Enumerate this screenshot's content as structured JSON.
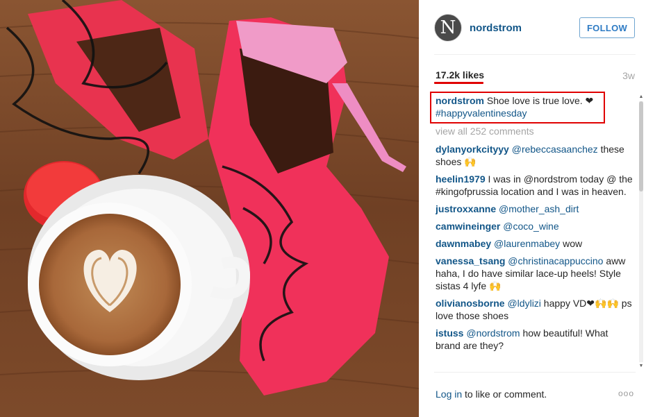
{
  "profile": {
    "username": "nordstrom",
    "avatar_letter": "N",
    "follow_label": "FOLLOW"
  },
  "post": {
    "likes": "17.2k likes",
    "time": "3w",
    "caption": {
      "user": "nordstrom",
      "text": " Shoe love is true love. ❤ ",
      "hashtag": "#happyvalentinesday"
    },
    "view_all": "view all 252 comments",
    "comments": [
      {
        "user": "dylanyorkcityyy",
        "mention": "@rebeccasaanchez",
        "text": " these shoes 🙌"
      },
      {
        "user": "heelin1979",
        "mention": "",
        "text": " I was in @nordstrom today @ the #kingofprussia location and I was in heaven."
      },
      {
        "user": "justroxxanne",
        "mention": "@mother_ash_dirt",
        "text": ""
      },
      {
        "user": "camwineinger",
        "mention": "@coco_wine",
        "text": ""
      },
      {
        "user": "dawnmabey",
        "mention": "@laurenmabey",
        "text": " wow"
      },
      {
        "user": "vanessa_tsang",
        "mention": "@christinacappuccino",
        "text": " aww haha, I do have similar lace-up heels! Style sistas 4 lyfe 🙌"
      },
      {
        "user": "olivianosborne",
        "mention": "@ldylizi",
        "text": " happy VD❤🙌🙌 ps love those shoes"
      },
      {
        "user": "istuss",
        "mention": "@nordstrom",
        "text": " how beautiful! What brand are they?"
      }
    ]
  },
  "footer": {
    "login_label": "Log in",
    "rest": " to like or comment.",
    "more_icon": "ooo"
  },
  "colors": {
    "link": "#125688",
    "follow_border": "#6fa5d0",
    "highlight": "#e00000"
  },
  "icons": {
    "more": "more-options-icon",
    "scroll_up": "scroll-up-arrow-icon",
    "scroll_down": "scroll-down-arrow-icon"
  }
}
